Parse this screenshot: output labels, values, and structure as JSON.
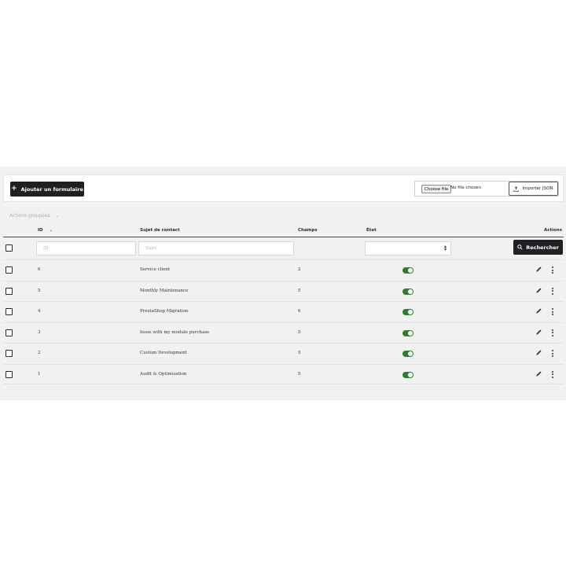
{
  "toolbar": {
    "add_label": "Ajouter un formulaire",
    "choose_file_label": "Choose file",
    "no_file_text": "No file chosen",
    "import_label": "Importer JSON"
  },
  "bulk_actions": {
    "label": "Actions groupées"
  },
  "table": {
    "headers": {
      "id": "ID",
      "subject": "Sujet de contact",
      "fields": "Champs",
      "state": "État",
      "actions": "Actions"
    },
    "filters": {
      "id_placeholder": "ID",
      "subject_placeholder": "Sujet",
      "search_label": "Rechercher"
    },
    "rows": [
      {
        "id": "6",
        "subject": "Service client",
        "fields": "2",
        "enabled": true
      },
      {
        "id": "5",
        "subject": "Monthly Maintenance",
        "fields": "5",
        "enabled": true
      },
      {
        "id": "4",
        "subject": "PrestaShop Migration",
        "fields": "6",
        "enabled": true
      },
      {
        "id": "3",
        "subject": "Issue with my module purchase",
        "fields": "5",
        "enabled": true
      },
      {
        "id": "2",
        "subject": "Custom Development",
        "fields": "5",
        "enabled": true
      },
      {
        "id": "1",
        "subject": "Audit & Optimisation",
        "fields": "5",
        "enabled": true
      }
    ]
  },
  "colors": {
    "primary_button": "#1f2023",
    "toggle_on": "#2e7d32",
    "panel_bg": "#f1f1f1"
  },
  "icons": {
    "add": "plus-icon",
    "import": "upload-icon",
    "search": "search-icon",
    "sort": "chevron-down-icon",
    "edit": "pencil-icon",
    "more": "kebab-icon"
  }
}
